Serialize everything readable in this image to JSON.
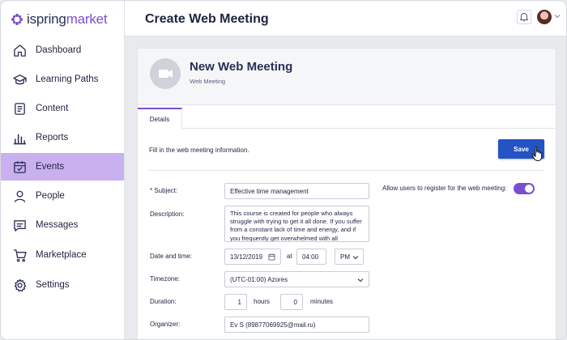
{
  "app": {
    "brand_left": "ispring",
    "brand_right": "market"
  },
  "sidebar": {
    "items": [
      {
        "label": "Dashboard",
        "icon": "home-icon"
      },
      {
        "label": "Learning Paths",
        "icon": "graduation-cap-icon"
      },
      {
        "label": "Content",
        "icon": "document-icon"
      },
      {
        "label": "Reports",
        "icon": "bar-chart-icon"
      },
      {
        "label": "Events",
        "icon": "calendar-icon",
        "active": true
      },
      {
        "label": "People",
        "icon": "person-icon"
      },
      {
        "label": "Messages",
        "icon": "message-icon"
      },
      {
        "label": "Marketplace",
        "icon": "cart-icon"
      },
      {
        "label": "Settings",
        "icon": "gear-icon"
      }
    ]
  },
  "header": {
    "title": "Create Web Meeting"
  },
  "meeting": {
    "title": "New Web Meeting",
    "subtitle": "Web Meeting"
  },
  "tabs": [
    {
      "label": "Details"
    }
  ],
  "form": {
    "hint": "Fill in the web meeting information.",
    "save_label": "Save",
    "subject_label": "* Subject:",
    "subject_value": "Effective time management",
    "description_label": "Description:",
    "description_value": "This course is created for people who always struggle with trying to get it all done. If you suffer from a constant lack of time and energy, and if you frequently get overwhelmed with all",
    "datetime_label": "Date and time:",
    "date_value": "13/12/2019",
    "at_label": "at",
    "time_value": "04:00",
    "ampm_value": "PM",
    "timezone_label": "Timezone:",
    "timezone_value": "(UTC-01:00) Azores",
    "duration_label": "Duration:",
    "hours_value": "1",
    "hours_label": "hours",
    "minutes_value": "0",
    "minutes_label": "minutes",
    "organizer_label": "Organizer:",
    "organizer_value": "Ev S (89877069925@mail.ru)",
    "register_label": "Allow users to register for the web meeting:",
    "register_enabled": true
  },
  "colors": {
    "accent": "#7b4fcf",
    "active_nav": "#c9b0ef",
    "primary_button": "#2453c5"
  }
}
